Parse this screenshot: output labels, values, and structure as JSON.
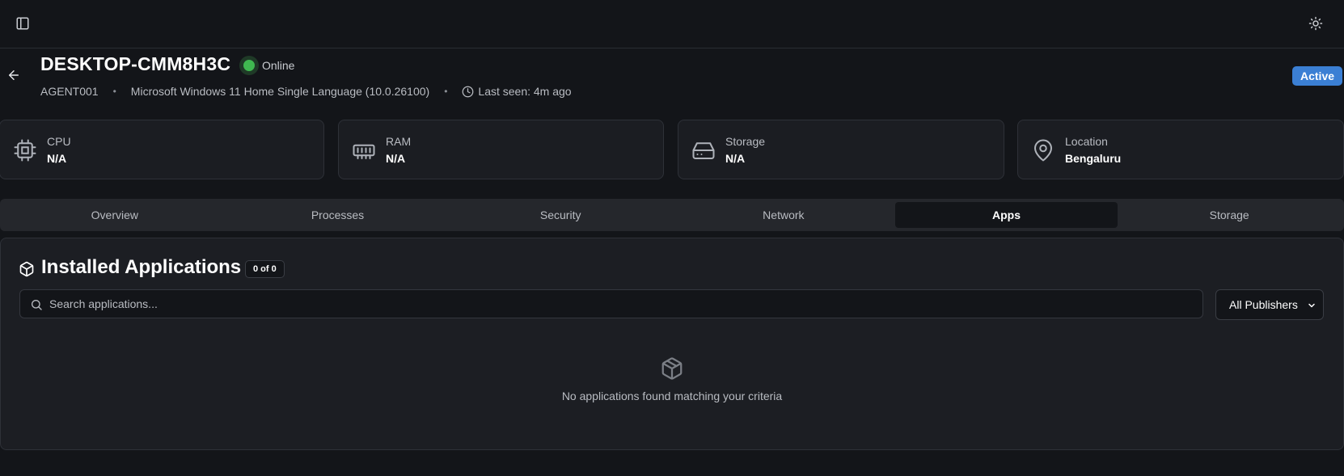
{
  "header": {
    "device_name": "DESKTOP-CMM8H3C",
    "status": "Online",
    "badge": "Active",
    "agent_id": "AGENT001",
    "os": "Microsoft Windows 11 Home Single Language (10.0.26100)",
    "last_seen": "Last seen: 4m ago",
    "separator": "•"
  },
  "stats": [
    {
      "label": "CPU",
      "value": "N/A",
      "icon": "cpu-icon"
    },
    {
      "label": "RAM",
      "value": "N/A",
      "icon": "memory-icon"
    },
    {
      "label": "Storage",
      "value": "N/A",
      "icon": "hard-drive-icon"
    },
    {
      "label": "Location",
      "value": "Bengaluru",
      "icon": "map-pin-icon"
    }
  ],
  "tabs": [
    {
      "label": "Overview"
    },
    {
      "label": "Processes"
    },
    {
      "label": "Security"
    },
    {
      "label": "Network"
    },
    {
      "label": "Apps",
      "active": true
    },
    {
      "label": "Storage"
    }
  ],
  "apps": {
    "title": "Installed Applications",
    "count": "0 of 0",
    "search_placeholder": "Search applications...",
    "publisher_filter": "All Publishers",
    "empty_message": "No applications found matching your criteria"
  },
  "colors": {
    "background": "#131519",
    "card": "#1b1d22",
    "accent": "#3b7fd4",
    "online": "#3fb950"
  }
}
